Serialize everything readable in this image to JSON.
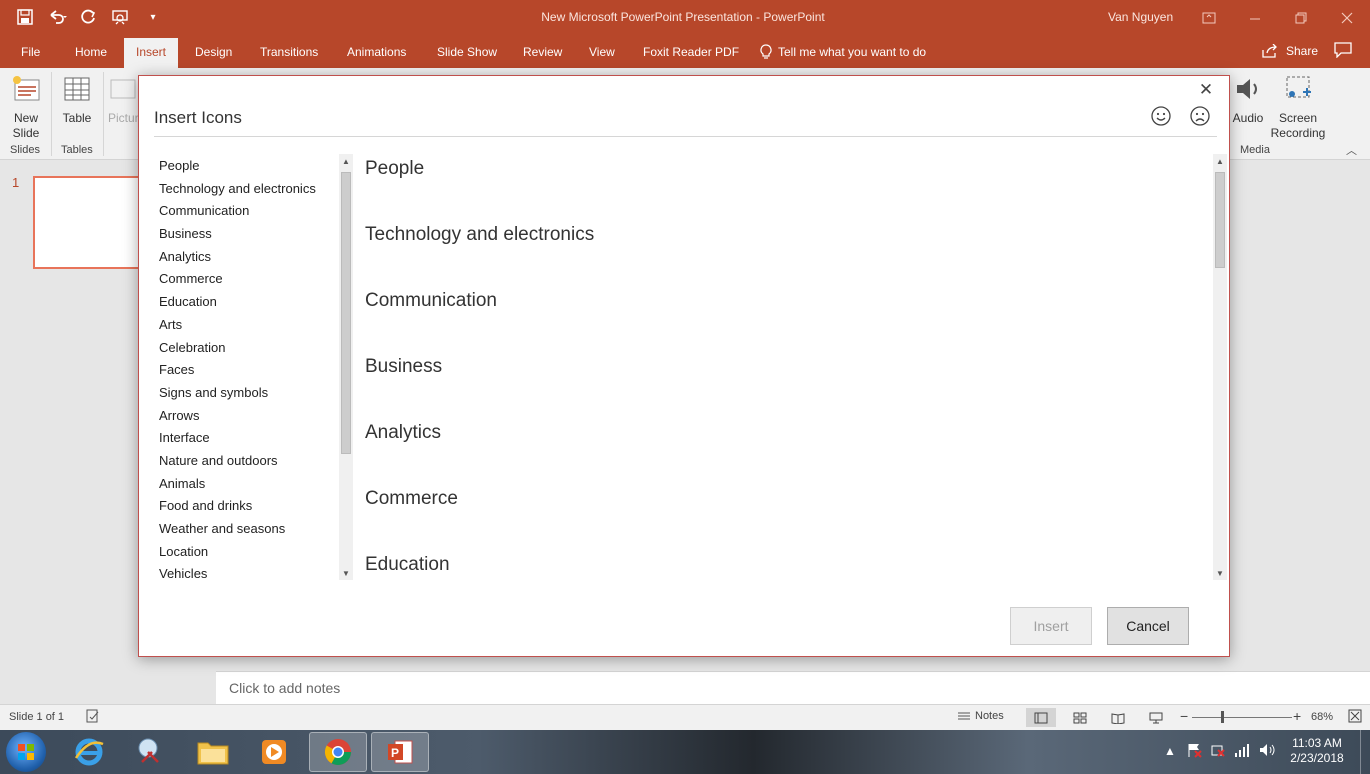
{
  "window": {
    "title": "New Microsoft PowerPoint Presentation  -  PowerPoint",
    "user": "Van Nguyen"
  },
  "tabs": [
    {
      "label": "File"
    },
    {
      "label": "Home"
    },
    {
      "label": "Insert",
      "active": true
    },
    {
      "label": "Design"
    },
    {
      "label": "Transitions"
    },
    {
      "label": "Animations"
    },
    {
      "label": "Slide Show"
    },
    {
      "label": "Review"
    },
    {
      "label": "View"
    },
    {
      "label": "Foxit Reader PDF"
    }
  ],
  "tell_me": "Tell me what you want to do",
  "share": "Share",
  "ribbon": {
    "new_slide_line1": "New",
    "new_slide_line2": "Slide",
    "table": "Table",
    "pictures_partial": "Pictur",
    "audio": "Audio",
    "screen_recording_line1": "Screen",
    "screen_recording_line2": "Recording",
    "groups": {
      "slides": "Slides",
      "tables": "Tables",
      "media": "Media"
    }
  },
  "thumbnails": {
    "slide_number": "1"
  },
  "notes_placeholder": "Click to add notes",
  "status": {
    "slide_info": "Slide 1 of 1",
    "notes_button": "Notes",
    "zoom_minus": "−",
    "zoom_plus": "+",
    "zoom": "68%"
  },
  "dialog": {
    "title": "Insert Icons",
    "categories": [
      "People",
      "Technology and electronics",
      "Communication",
      "Business",
      "Analytics",
      "Commerce",
      "Education",
      "Arts",
      "Celebration",
      "Faces",
      "Signs and symbols",
      "Arrows",
      "Interface",
      "Nature and outdoors",
      "Animals",
      "Food and drinks",
      "Weather and seasons",
      "Location",
      "Vehicles"
    ],
    "sections": [
      "People",
      "Technology and electronics",
      "Communication",
      "Business",
      "Analytics",
      "Commerce",
      "Education"
    ],
    "insert_button": "Insert",
    "cancel_button": "Cancel"
  },
  "taskbar": {
    "time": "11:03 AM",
    "date": "2/23/2018"
  }
}
